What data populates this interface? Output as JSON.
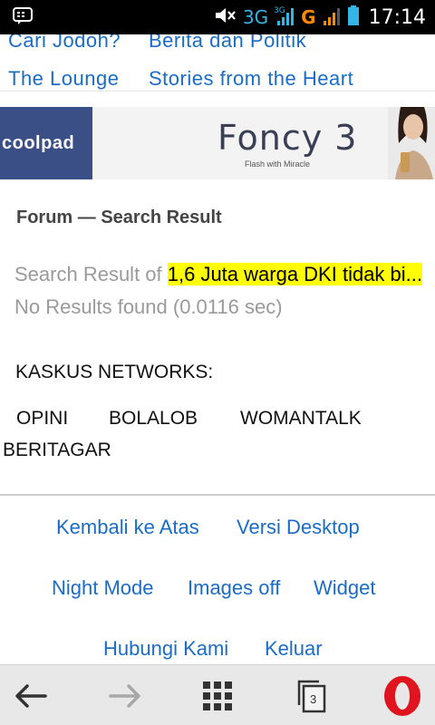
{
  "status_bar": {
    "network_3g": "3G",
    "network_3g_small": "3G",
    "network_g": "G",
    "time": "17:14"
  },
  "forum_links": [
    "Cari Jodoh?",
    "Berita dan Politik",
    "The Lounge",
    "Stories from the Heart"
  ],
  "ad": {
    "brand": "coolpad",
    "title": "Foncy 3",
    "subtitle": "Flash with Miracle"
  },
  "page": {
    "heading": "Forum — Search Result",
    "result_prefix": "Search Result of ",
    "result_query": "1,6 Juta warga DKI tidak bi...",
    "result_suffix": " No Results found (0.0116 sec)"
  },
  "networks": {
    "title": "KASKUS NETWORKS:",
    "items": [
      "OPINI",
      "BOLALOB",
      "WOMANTALK",
      "BERITAGAR"
    ]
  },
  "footer_links": [
    "Kembali ke Atas",
    "Versi Desktop",
    "Night Mode",
    "Images off",
    "Widget",
    "Hubungi Kami",
    "Keluar"
  ],
  "browser_bar": {
    "tab_count": "3",
    "icons": [
      "back-arrow-icon",
      "forward-arrow-icon",
      "speed-dial-grid-icon",
      "tabs-icon",
      "opera-logo-icon"
    ]
  },
  "colors": {
    "link": "#1a6cc7",
    "highlight": "#ffff00",
    "ad_brand_bg": "#3b4f87",
    "network_3g": "#33b5e5",
    "network_g": "#ff8a00"
  }
}
